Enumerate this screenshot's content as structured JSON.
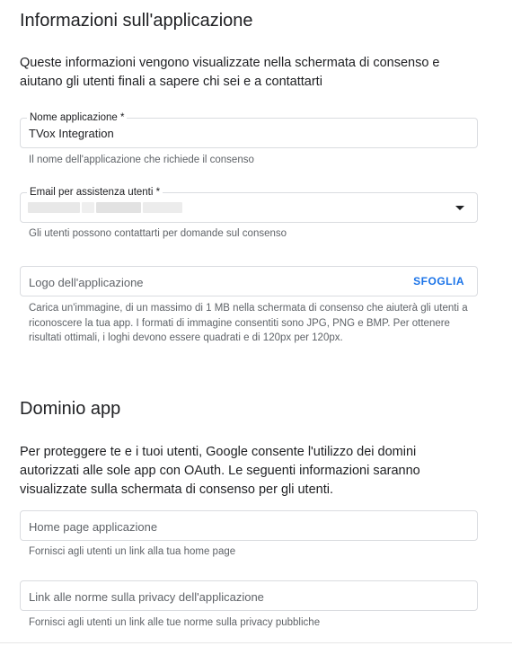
{
  "app_info": {
    "title": "Informazioni sull'applicazione",
    "description": "Queste informazioni vengono visualizzate nella schermata di consenso e aiutano gli utenti finali a sapere chi sei e a contattarti",
    "app_name": {
      "label": "Nome applicazione *",
      "value": "TVox Integration",
      "hint": "Il nome dell'applicazione che richiede il consenso"
    },
    "support_email": {
      "label": "Email per assistenza utenti *",
      "hint": "Gli utenti possono contattarti per domande sul consenso",
      "icon": "dropdown-arrow-icon"
    },
    "logo": {
      "placeholder": "Logo dell'applicazione",
      "button_label": "SFOGLIA",
      "hint": "Carica un'immagine, di un massimo di 1 MB nella schermata di consenso che aiuterà gli utenti a riconoscere la tua app. I formati di immagine consentiti sono JPG, PNG e BMP. Per ottenere risultati ottimali, i loghi devono essere quadrati e di 120px per 120px."
    }
  },
  "app_domain": {
    "title": "Dominio app",
    "description": "Per proteggere te e i tuoi utenti, Google consente l'utilizzo dei domini autorizzati alle sole app con OAuth. Le seguenti informazioni saranno visualizzate sulla schermata di consenso per gli utenti.",
    "homepage": {
      "placeholder": "Home page applicazione",
      "hint": "Fornisci agli utenti un link alla tua home page"
    },
    "privacy": {
      "placeholder": "Link alle norme sulla privacy dell'applicazione",
      "hint": "Fornisci agli utenti un link alle tue norme sulla privacy pubbliche"
    }
  },
  "colors": {
    "accent": "#1a73e8",
    "text": "#202124",
    "secondary_text": "#5f6368",
    "border": "#dadce0"
  }
}
